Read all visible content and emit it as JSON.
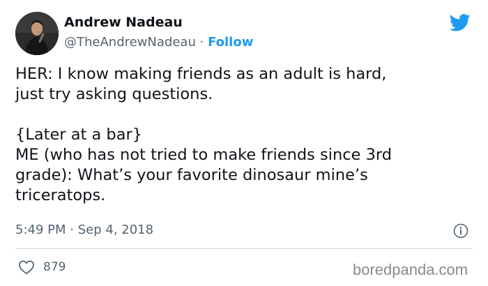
{
  "author": {
    "name": "Andrew Nadeau",
    "handle": "@TheAndrewNadeau",
    "separator": "·",
    "follow_label": "Follow"
  },
  "tweet": {
    "lines": [
      "HER: I know making friends as an adult is hard,",
      "just try asking questions.",
      "",
      "{Later at a bar}",
      "ME (who has not tried to make friends since 3rd",
      "grade): What’s your favorite dinosaur mine’s",
      "triceratops."
    ],
    "time": "5:49 PM",
    "date_separator": "·",
    "date": "Sep 4, 2018"
  },
  "actions": {
    "like_count": "879"
  },
  "icons": {
    "platform": "twitter-bird-icon",
    "info": "info-icon",
    "like": "heart-icon"
  },
  "colors": {
    "accent": "#1d9bf0",
    "text": "#0f1419",
    "muted": "#536471"
  },
  "watermark": "boredpanda.com"
}
